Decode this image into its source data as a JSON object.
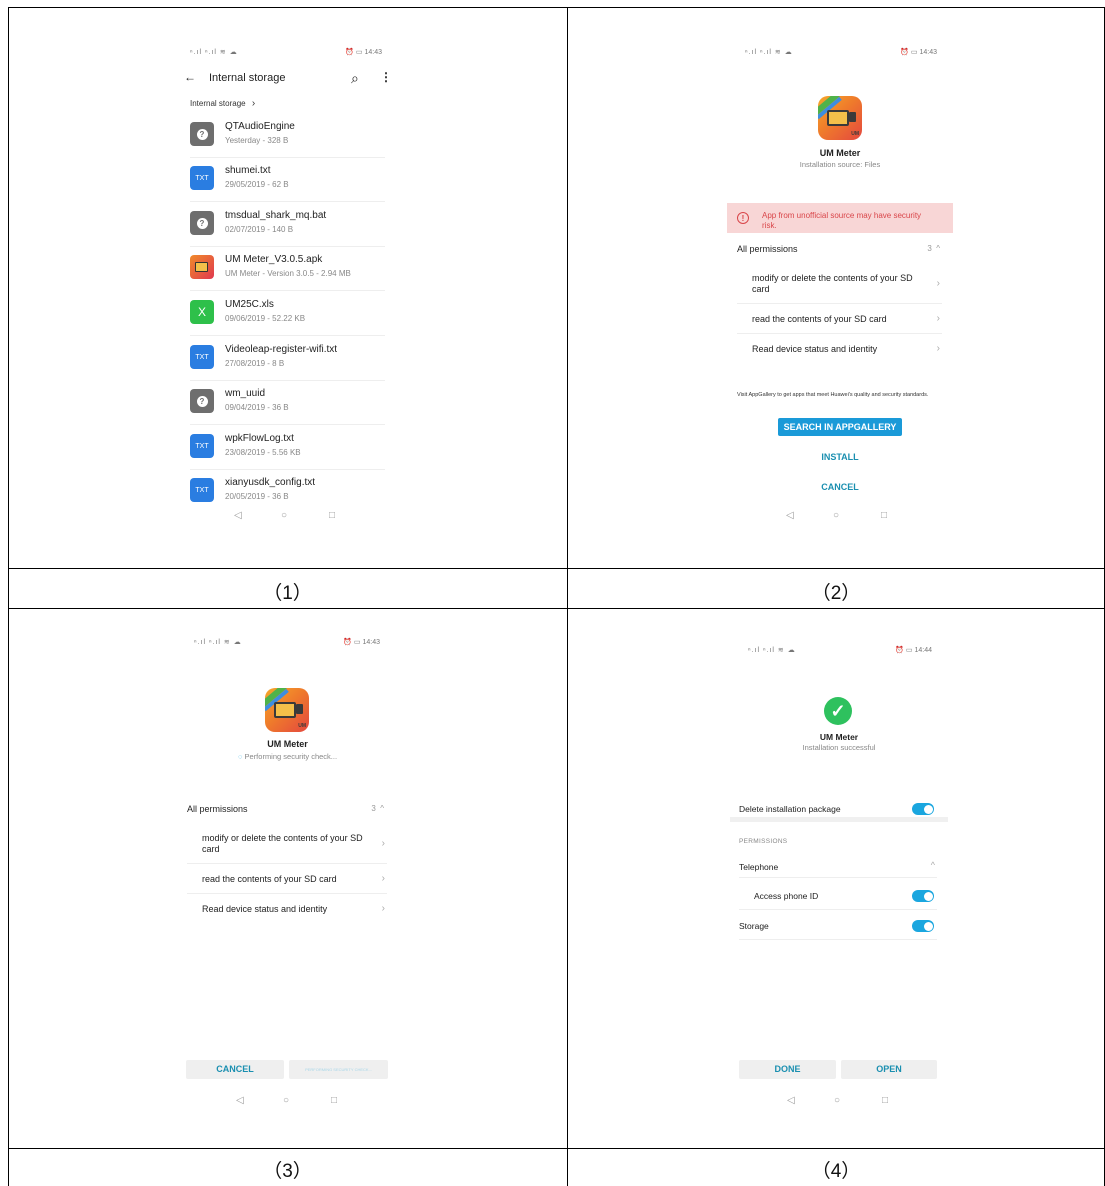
{
  "captions": [
    "（1）",
    "（2）",
    "（3）",
    "（4）"
  ],
  "common": {
    "status_left": "ⁿ.ıl ⁿ.ıl ≋ ☁",
    "nav_back": "◁",
    "nav_home": "○",
    "nav_recent": "□"
  },
  "panel1": {
    "status_right": "⏰ ▭ 14:43",
    "title": "Internal storage",
    "breadcrumb": "Internal storage",
    "files": [
      {
        "name": "QTAudioEngine",
        "meta": "Yesterday - 328 B",
        "type": "unknown"
      },
      {
        "name": "shumei.txt",
        "meta": "29/05/2019 - 62 B",
        "type": "txt"
      },
      {
        "name": "tmsdual_shark_mq.bat",
        "meta": "02/07/2019 - 140 B",
        "type": "unknown"
      },
      {
        "name": "UM Meter_V3.0.5.apk",
        "meta": "UM Meter - Version 3.0.5 - 2.94 MB",
        "type": "apk"
      },
      {
        "name": "UM25C.xls",
        "meta": "09/06/2019 - 52.22 KB",
        "type": "xls"
      },
      {
        "name": "Videoleap-register-wifi.txt",
        "meta": "27/08/2019 - 8 B",
        "type": "txt"
      },
      {
        "name": "wm_uuid",
        "meta": "09/04/2019 - 36 B",
        "type": "unknown"
      },
      {
        "name": "wpkFlowLog.txt",
        "meta": "23/08/2019 - 5.56 KB",
        "type": "txt"
      },
      {
        "name": "xianyusdk_config.txt",
        "meta": "20/05/2019 - 36 B",
        "type": "txt"
      }
    ],
    "txt_label": "TXT",
    "xls_label": "X",
    "unknown_label": "?"
  },
  "panel2": {
    "status_right": "⏰ ▭ 14:43",
    "app_name": "UM Meter",
    "source": "Installation source: Files",
    "warning": "App from unofficial source may have security risk.",
    "perm_header": "All permissions",
    "perm_count": "3",
    "permissions": [
      "modify or delete the contents of your SD card",
      "read the contents of your SD card",
      "Read device status and identity"
    ],
    "notice": "Visit AppGallery to get apps that meet Huawei's quality and security standards.",
    "search_btn": "SEARCH IN APPGALLERY",
    "install_btn": "INSTALL",
    "cancel_btn": "CANCEL"
  },
  "panel3": {
    "status_right": "⏰ ▭ 14:43",
    "app_name": "UM Meter",
    "checking": "Performing security check...",
    "perm_header": "All permissions",
    "perm_count": "3",
    "permissions": [
      "modify or delete the contents of your SD card",
      "read the contents of your SD card",
      "Read device status and identity"
    ],
    "cancel_btn": "CANCEL",
    "checking_btn": "PERFORMING SECURITY CHECK..."
  },
  "panel4": {
    "status_right": "⏰ ▭ 14:44",
    "app_name": "UM Meter",
    "status": "Installation successful",
    "delete_pkg": "Delete installation package",
    "permissions_label": "PERMISSIONS",
    "telephone": "Telephone",
    "access_phone_id": "Access phone ID",
    "storage": "Storage",
    "done_btn": "DONE",
    "open_btn": "OPEN"
  }
}
